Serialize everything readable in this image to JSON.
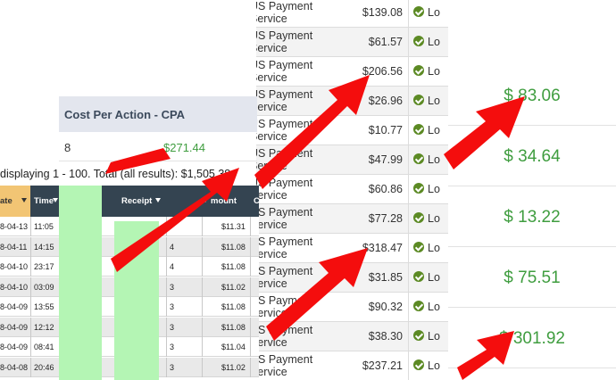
{
  "payments": [
    {
      "desc": "US Payment Service",
      "amount": "$139.08",
      "status": "Lo"
    },
    {
      "desc": "US Payment Service",
      "amount": "$61.57",
      "status": "Lo"
    },
    {
      "desc": "US Payment Service",
      "amount": "$206.56",
      "status": "Lo"
    },
    {
      "desc": "US Payment Service",
      "amount": "$26.96",
      "status": "Lo"
    },
    {
      "desc": "US Payment Service",
      "amount": "$10.77",
      "status": "Lo"
    },
    {
      "desc": "US Payment Service",
      "amount": "$47.99",
      "status": "Lo"
    },
    {
      "desc": "US Payment Service",
      "amount": "$60.86",
      "status": "Lo"
    },
    {
      "desc": "US Payment Service",
      "amount": "$77.28",
      "status": "Lo"
    },
    {
      "desc": "US Payment Service",
      "amount": "$318.47",
      "status": "Lo"
    },
    {
      "desc": "US Payment Service",
      "amount": "$31.85",
      "status": "Lo"
    },
    {
      "desc": "US Payment Service",
      "amount": "$90.32",
      "status": "Lo"
    },
    {
      "desc": "US Payment Service",
      "amount": "$38.30",
      "status": "Lo"
    },
    {
      "desc": "US Payment Service",
      "amount": "$237.21",
      "status": "Lo"
    }
  ],
  "right_amounts": [
    "$ 83.06",
    "$ 34.64",
    "$ 13.22",
    "$ 75.51",
    "$ 301.92"
  ],
  "cpa": {
    "title": "Cost Per Action - CPA",
    "count": "8",
    "amount": "$271.44"
  },
  "summary": "displaying 1 - 100.   Total (all results): $1,505.38",
  "grid": {
    "headers": {
      "date": "ate",
      "time": "Time",
      "receipt": "Receipt",
      "amount": "mount",
      "last": "C"
    },
    "rows": [
      {
        "date": "8-04-13",
        "time": "11:05",
        "qty": "",
        "amount": "$11.31"
      },
      {
        "date": "8-04-11",
        "time": "14:15",
        "qty": "4",
        "amount": "$11.08"
      },
      {
        "date": "8-04-10",
        "time": "23:17",
        "qty": "4",
        "amount": "$11.08"
      },
      {
        "date": "8-04-10",
        "time": "03:09",
        "qty": "3",
        "amount": "$11.02"
      },
      {
        "date": "8-04-09",
        "time": "13:55",
        "qty": "3",
        "amount": "$11.08"
      },
      {
        "date": "8-04-09",
        "time": "12:12",
        "qty": "3",
        "amount": "$11.08"
      },
      {
        "date": "8-04-09",
        "time": "08:41",
        "qty": "3",
        "amount": "$11.04"
      },
      {
        "date": "8-04-08",
        "time": "20:46",
        "qty": "3",
        "amount": "$11.02"
      }
    ]
  },
  "colors": {
    "accent_green": "#3f9d3f",
    "header_dark": "#344451",
    "arrow_red": "#f40d0d",
    "redaction": "#b4f5b4"
  }
}
